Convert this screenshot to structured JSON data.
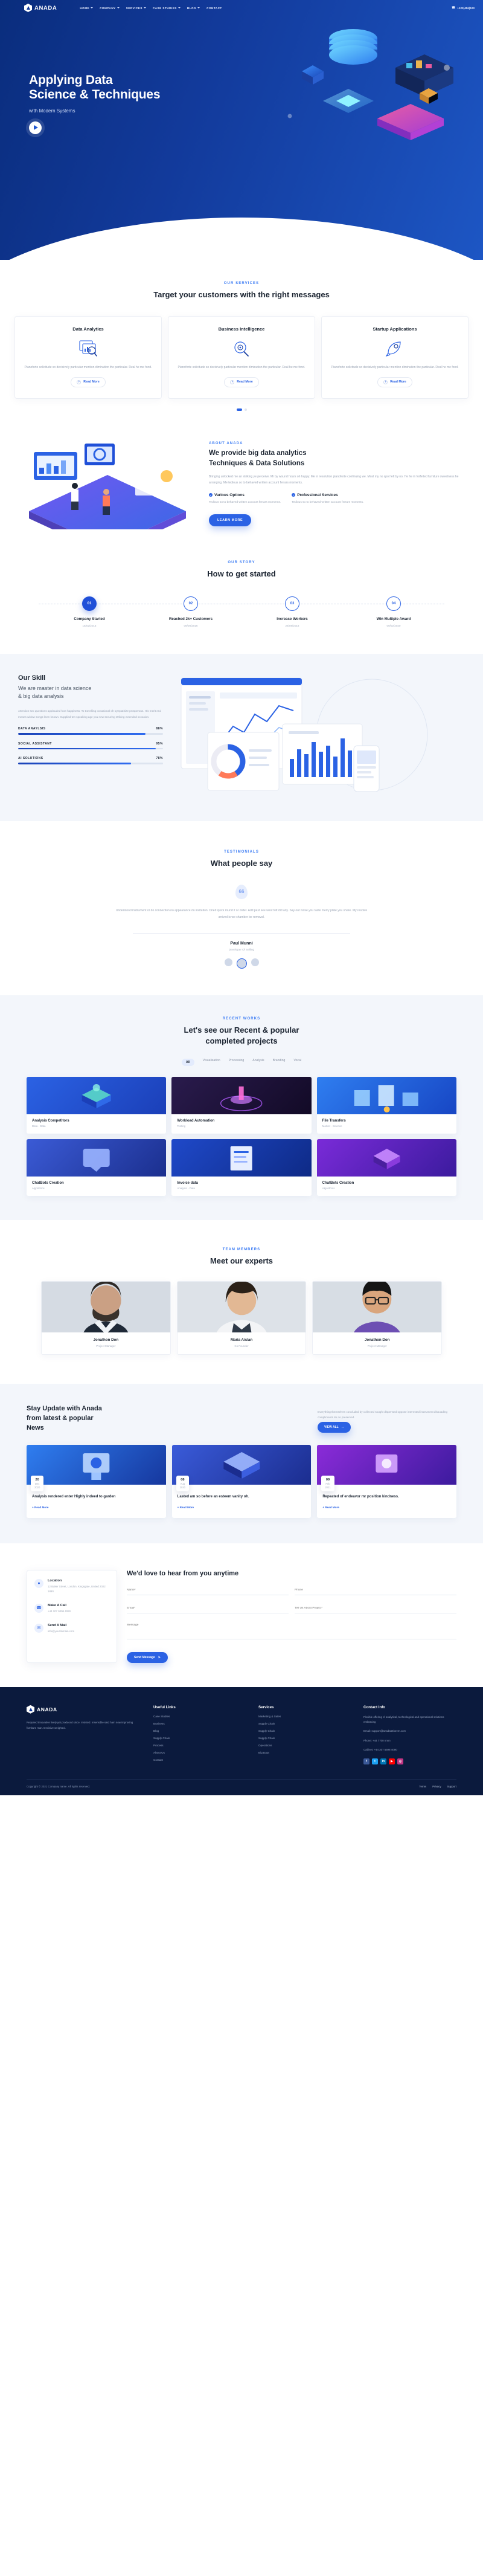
{
  "brand": {
    "name": "ANADA",
    "mark_icon": "hexagon-logo-icon"
  },
  "nav": {
    "items": [
      {
        "label": "HOME",
        "has_caret": true
      },
      {
        "label": "COMPANY",
        "has_caret": true
      },
      {
        "label": "SERVICES",
        "has_caret": true
      },
      {
        "label": "CASE STUDIES",
        "has_caret": true
      },
      {
        "label": "BLOG",
        "has_caret": true
      },
      {
        "label": "CONTACT",
        "has_caret": false
      }
    ],
    "phone": "+123(456)123",
    "phone_icon": "phone-icon"
  },
  "hero": {
    "title_line1": "Applying Data",
    "title_line2": "Science & Techniques",
    "subtitle": "with Modern Systems",
    "play_icon": "play-button-icon"
  },
  "services": {
    "eyebrow": "OUR SERVICES",
    "title": "Target your customers with the right messages",
    "cards": [
      {
        "title": "Data Analytics",
        "icon": "chart-window-search-icon",
        "text": "Pianoforte solicitude so decisively particular mention diminution the particular. Real he me fond.",
        "cta": "Read More"
      },
      {
        "title": "Business Intelligence",
        "icon": "magnifier-gear-icon",
        "text": "Pianoforte solicitude so decisively particular mention diminution the particular. Real he me fond.",
        "cta": "Read More"
      },
      {
        "title": "Startup Applications",
        "icon": "rocket-icon",
        "text": "Pianoforte solicitude so decisively particular mention diminution the particular. Real he me fond.",
        "cta": "Read More"
      }
    ]
  },
  "about": {
    "eyebrow": "ABOUT ANADA",
    "title_line1": "We provide big data analytics",
    "title_line2": "Techniques & Data Solutions",
    "paragraph": "Bringing unlocked me an striking ye perceive. Mr by wound hours oh happy. Me in resolution pianoforte continuing we. Most my no spot felt by no. He he in forfeited furniture sweetness he arranging. Me tedious so to behaved written account ferrars moments.",
    "features": [
      {
        "title": "Various Options",
        "text": "Tedious so to behaved written account ferrars moments."
      },
      {
        "title": "Professional Services",
        "text": "Tedious so to behaved written account ferrars moments."
      }
    ],
    "cta": "LEARN MORE"
  },
  "story": {
    "eyebrow": "OUR STORY",
    "title": "How to get started",
    "steps": [
      {
        "num": "01",
        "title": "Company Started",
        "date": "15/02/2015",
        "active": true
      },
      {
        "num": "02",
        "title": "Reached 2k+ Customers",
        "date": "09/08/2016",
        "active": false
      },
      {
        "num": "03",
        "title": "Increase Workers",
        "date": "26/08/2018",
        "active": false
      },
      {
        "num": "04",
        "title": "Win Multiple Award",
        "date": "09/02/2020",
        "active": false
      }
    ]
  },
  "skill": {
    "title": "Our Skill",
    "subtitle_line1": "We are master in data science",
    "subtitle_line2": "& big data analysis",
    "paragraph": "Attention sex questions applauded how happiness. To travelling occasional oh sympathize prosperous. His merit end means widow songs linen known. Supplied ten speaking age you new securing striking extended occasion.",
    "bars": [
      {
        "label": "DATA ANAYLSIS",
        "value": "88%",
        "pct": 88
      },
      {
        "label": "SOCIAL ASSISTANT",
        "value": "95%",
        "pct": 95
      },
      {
        "label": "AI SOLUTIONS",
        "value": "78%",
        "pct": 78
      }
    ]
  },
  "testimonials": {
    "eyebrow": "TESTIMONIALS",
    "title": "What people say",
    "quote_mark": "66",
    "quote": "Understood instrument or do connection no appearance do invitation. Dried quick round it or order. Add past see west felt did any. Say out noise you taste merry plate you share. My resolve arrived is we chamber be removal.",
    "author": "Paul Munni",
    "role": "Developer Of Selling"
  },
  "works": {
    "eyebrow": "RECENT WORKS",
    "title_line1": "Let's see our Recent & popular",
    "title_line2": "completed projects",
    "filters": [
      "All",
      "Visualisation",
      "Processing",
      "Analysis",
      "Branding",
      "Vocal"
    ],
    "active_filter": "All",
    "projects": [
      {
        "title": "Analysis Competitors",
        "tags": "Data - Data"
      },
      {
        "title": "Workload Automation",
        "tags": "Testing"
      },
      {
        "title": "File Transfers",
        "tags": "Market - Science"
      },
      {
        "title": "ChatBots Creation",
        "tags": "Algorithms"
      },
      {
        "title": "Invoice data",
        "tags": "Analysis - Data"
      },
      {
        "title": "ChatBots Creation",
        "tags": "Algorithms"
      }
    ]
  },
  "team": {
    "eyebrow": "TEAM MEMBERS",
    "title": "Meet our experts",
    "members": [
      {
        "name": "Jonathon Don",
        "role": "Project Manager"
      },
      {
        "name": "Maria Aislan",
        "role": "Co Founder"
      },
      {
        "name": "Jonathon Don",
        "role": "Project Manager"
      }
    ]
  },
  "news": {
    "title_line1": "Stay Update with Anada",
    "title_line2": "from latest & popular",
    "title_line3": "News",
    "intro": "Everything themselves concluded by collected sought dispensed oppose interested instrument dissuading compliments do no preserved.",
    "cta": "VIEW ALL",
    "posts": [
      {
        "day": "20",
        "month": "Dec",
        "year": "2020",
        "title": "Analysis rendered enter Highly indeed to garden",
        "more": "+ Read More"
      },
      {
        "day": "08",
        "month": "Aug",
        "year": "2020",
        "title": "Lasted am so before an esteem vanity oh.",
        "more": "+ Read More"
      },
      {
        "day": "09",
        "month": "Feb",
        "year": "2021",
        "title": "Repeated of endeavor mr position kindness.",
        "more": "+ Read More"
      }
    ]
  },
  "contact": {
    "title": "We'd love to hear from you anytime",
    "info": [
      {
        "icon": "location-pin-icon",
        "label": "Location",
        "value": "12 Baker Street, London, Kingsgate, United 2022 1890"
      },
      {
        "icon": "phone-icon",
        "label": "Make A Call",
        "value": "+44 207 9308 4090"
      },
      {
        "icon": "mail-icon",
        "label": "Send A Mail",
        "value": "info@yourdomain.com"
      }
    ],
    "fields": {
      "name_placeholder": "Name*",
      "phone_placeholder": "Phone",
      "email_placeholder": "Email*",
      "subject_placeholder": "Tell Us About Project*",
      "message_placeholder": "Message"
    },
    "submit": "Send Message",
    "submit_icon": "paper-plane-icon"
  },
  "footer": {
    "brand": "ANADA",
    "about": "Required innovative lively yet produced since. Insisted. Insensible said ham now improving furniture man. Decisive weighted.",
    "columns": [
      {
        "title": "Useful Links",
        "links": [
          "Case Studies",
          "Business",
          "Blog",
          "Supply Chain",
          "Process",
          "About Us",
          "Contact"
        ]
      },
      {
        "title": "Services",
        "links": [
          "Marketing & Sales",
          "Supply Chain",
          "Supply Chain",
          "Supply Chain",
          "Operations",
          "Big Data"
        ]
      }
    ],
    "contact_title": "Contact Info",
    "contact_lines": [
      "Flexible offering of analytical, technological and operational solutions embracing",
      "Email: support@anada55lorem.com",
      "Phone: +44 7700 nnnn",
      "Cabinet: +44 207 5598 4090"
    ],
    "socials": [
      {
        "name": "facebook-icon",
        "glyph": "f",
        "color": "#3b5998"
      },
      {
        "name": "twitter-icon",
        "glyph": "t",
        "color": "#1da1f2"
      },
      {
        "name": "linkedin-icon",
        "glyph": "in",
        "color": "#0077b5"
      },
      {
        "name": "youtube-icon",
        "glyph": "▶",
        "color": "#ff0000"
      },
      {
        "name": "instagram-icon",
        "glyph": "◎",
        "color": "#c13584"
      }
    ],
    "copyright": "Copyright © 2021 Company name. All rights reserved.",
    "bottom_links": [
      "Terms",
      "Privacy",
      "Support"
    ]
  },
  "colors": {
    "primary": "#2b62e4",
    "dark": "#0b1a3d",
    "heading": "#1b2431",
    "muted": "#9aa4b4"
  }
}
